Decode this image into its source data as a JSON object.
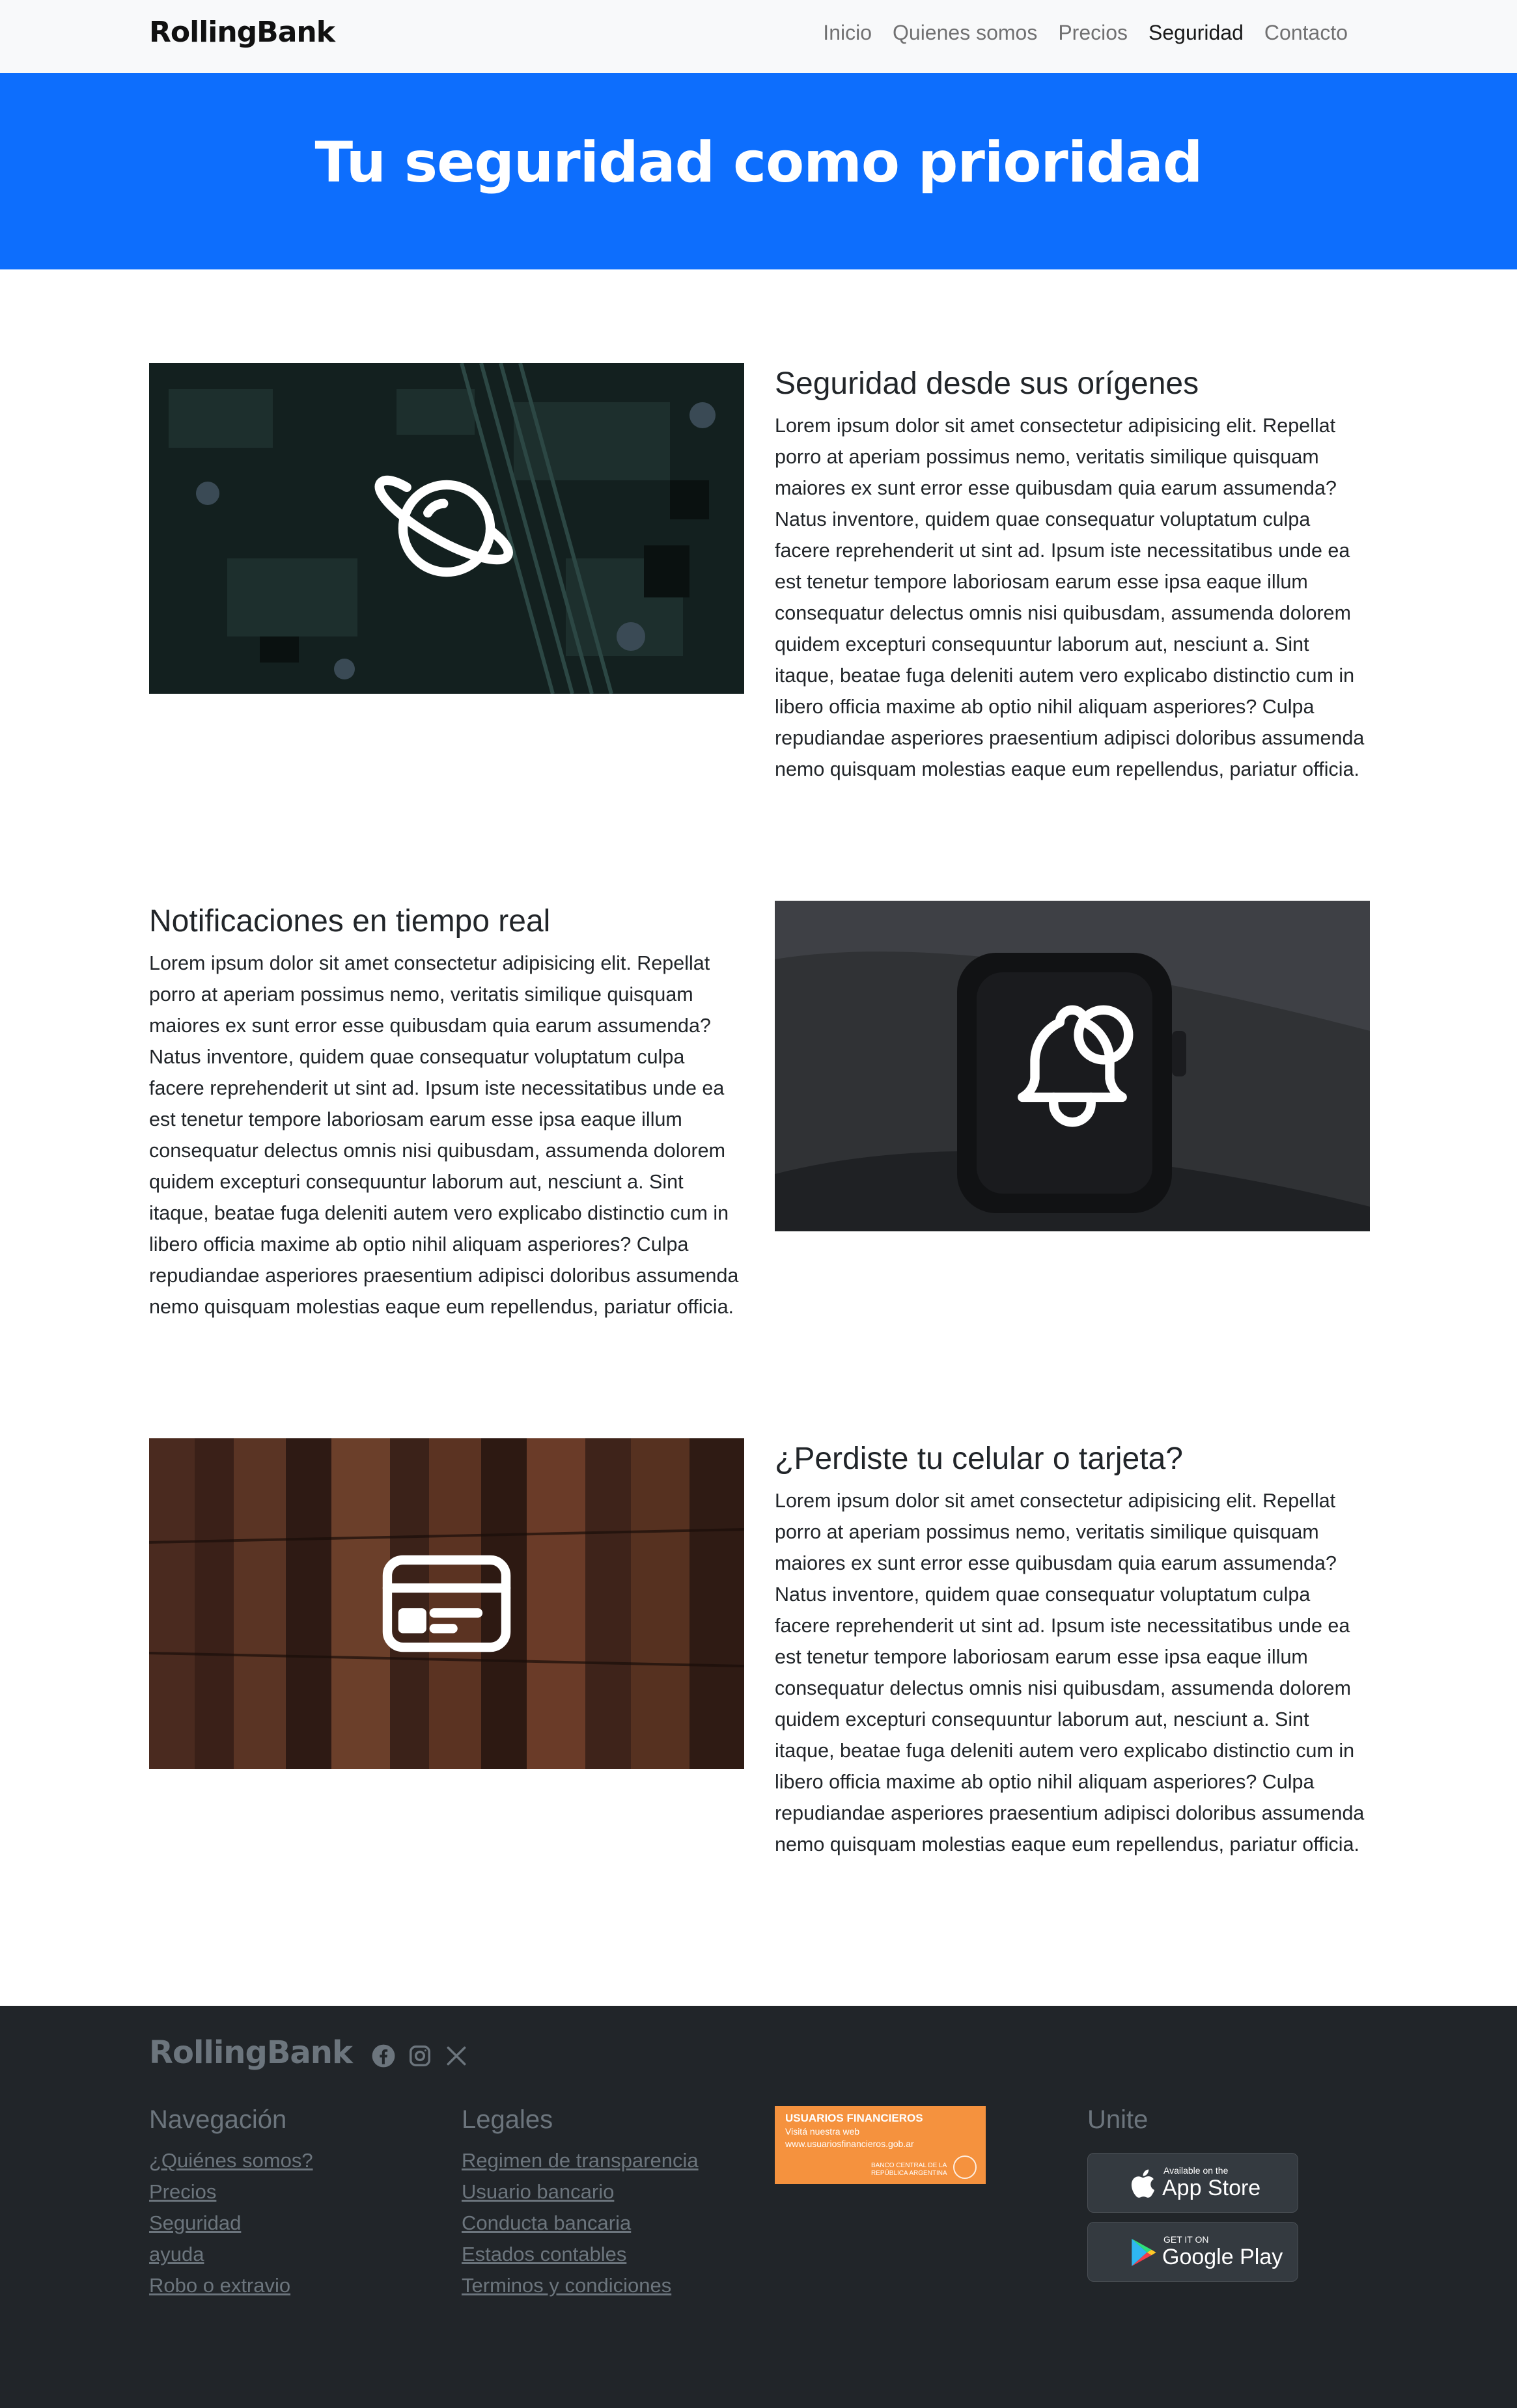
{
  "nav": {
    "brand": "RollingBank",
    "links": [
      "Inicio",
      "Quienes somos",
      "Precios",
      "Seguridad",
      "Contacto"
    ],
    "active_index": 3
  },
  "hero": {
    "title": "Tu seguridad como prioridad",
    "bg_color": "#0d6efd"
  },
  "features": [
    {
      "title": "Seguridad desde sus orígenes",
      "body": "Lorem ipsum dolor sit amet consectetur adipisicing elit. Repellat porro at aperiam possimus nemo, veritatis similique quisquam maiores ex sunt error esse quibusdam quia earum assumenda? Natus inventore, quidem quae consequatur voluptatum culpa facere reprehenderit ut sint ad. Ipsum iste necessitatibus unde ea est tenetur tempore laboriosam earum esse ipsa eaque illum consequatur delectus omnis nisi quibusdam, assumenda dolorem quidem excepturi consequuntur laborum aut, nesciunt a. Sint itaque, beatae fuga deleniti autem vero explicabo distinctio cum in libero officia maxime ab optio nihil aliquam asperiores? Culpa repudiandae asperiores praesentium adipisci doloribus assumenda nemo quisquam molestias eaque eum repellendus, pariatur officia.",
      "icon": "planet-icon"
    },
    {
      "title": "Notificaciones en tiempo real",
      "body": "Lorem ipsum dolor sit amet consectetur adipisicing elit. Repellat porro at aperiam possimus nemo, veritatis similique quisquam maiores ex sunt error esse quibusdam quia earum assumenda? Natus inventore, quidem quae consequatur voluptatum culpa facere reprehenderit ut sint ad. Ipsum iste necessitatibus unde ea est tenetur tempore laboriosam earum esse ipsa eaque illum consequatur delectus omnis nisi quibusdam, assumenda dolorem quidem excepturi consequuntur laborum aut, nesciunt a. Sint itaque, beatae fuga deleniti autem vero explicabo distinctio cum in libero officia maxime ab optio nihil aliquam asperiores? Culpa repudiandae asperiores praesentium adipisci doloribus assumenda nemo quisquam molestias eaque eum repellendus, pariatur officia.",
      "icon": "bell-notification-icon"
    },
    {
      "title": "¿Perdiste tu celular o tarjeta?",
      "body": "Lorem ipsum dolor sit amet consectetur adipisicing elit. Repellat porro at aperiam possimus nemo, veritatis similique quisquam maiores ex sunt error esse quibusdam quia earum assumenda? Natus inventore, quidem quae consequatur voluptatum culpa facere reprehenderit ut sint ad. Ipsum iste necessitatibus unde ea est tenetur tempore laboriosam earum esse ipsa eaque illum consequatur delectus omnis nisi quibusdam, assumenda dolorem quidem excepturi consequuntur laborum aut, nesciunt a. Sint itaque, beatae fuga deleniti autem vero explicabo distinctio cum in libero officia maxime ab optio nihil aliquam asperiores? Culpa repudiandae asperiores praesentium adipisci doloribus assumenda nemo quisquam molestias eaque eum repellendus, pariatur officia.",
      "icon": "credit-card-icon"
    }
  ],
  "footer": {
    "brand": "RollingBank",
    "social_icons": [
      "facebook-icon",
      "instagram-icon",
      "x-icon"
    ],
    "nav_title": "Navegación",
    "nav_links": [
      "¿Quiénes somos?",
      "Precios",
      "Seguridad",
      "ayuda",
      "Robo o extravio"
    ],
    "legal_title": "Legales",
    "legal_links": [
      "Regimen de transparencia",
      "Usuario bancario",
      "Conducta bancaria",
      "Estados contables",
      "Terminos y condiciones"
    ],
    "uf_badge": {
      "line1": "USUARIOS FINANCIEROS",
      "line2": "Visitá nuestra web",
      "line3": "www.usuariosfinancieros.gob.ar",
      "seal_text": "BANCO CENTRAL DE LA REPÚBLICA ARGENTINA"
    },
    "join_title": "Unite",
    "app_store": {
      "small": "Available on the",
      "big": "App Store"
    },
    "google_play": {
      "small": "GET IT ON",
      "big": "Google Play"
    },
    "bg_color": "#212529"
  }
}
